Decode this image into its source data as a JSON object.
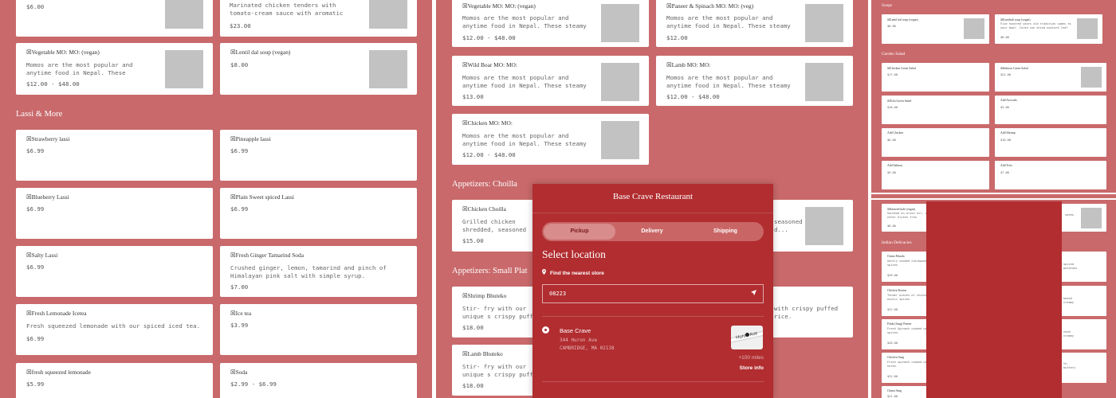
{
  "p1": {
    "top_cards": [
      {
        "price": "$6.00"
      },
      {
        "desc": "Marinated chicken tenders with tomato-cream sauce with aromatic spices. One of the most...",
        "price": "$23.00"
      }
    ],
    "veg_row": [
      {
        "name": "☒Vegetable MO: MO: (vegan)",
        "desc": "Momos are the most popular and anytime food in Nepal. These steamy and juicy dumplings a...",
        "price": "$12.00 - $48.00"
      },
      {
        "name": "☒Lentil dal soup (vegan)",
        "price": "$8.00"
      }
    ],
    "section": "Lassi & More",
    "items": [
      {
        "name": "☒Strawberry lassi",
        "price": "$6.99"
      },
      {
        "name": "☒Pineapple lassi",
        "price": "$6.99"
      },
      {
        "name": "☒Blueberry Lassi",
        "price": "$6.99"
      },
      {
        "name": "☒Plain Sweet spiced Lassi",
        "price": "$6.99"
      },
      {
        "name": "☒Salty Lassi",
        "price": "$6.99"
      },
      {
        "name": "☒Fresh Ginger Tamarind Soda",
        "desc": "Crushed ginger, lemon, tamarind and pinch of Himalayan pink salt with simple syrup.",
        "price": "$7.00"
      },
      {
        "name": "☒Fresh Lemonade Icetea",
        "desc": "Fresh squeezed lemonade with our spiced iced tea.",
        "price": "$6.99"
      },
      {
        "name": "☒Ice tea",
        "price": "$3.99"
      },
      {
        "name": "☒fresh squeezed lemonade",
        "price": "$5.99"
      },
      {
        "name": "☒Soda",
        "price": "$2.99 - $6.99"
      }
    ]
  },
  "p2": {
    "momo": [
      {
        "name": "☒Vegetable MO: MO: (vegan)",
        "desc": "Momos are the most popular and anytime food in Nepal. These steamy and juicy dumplings a...",
        "price": "$12.00 - $48.00"
      },
      {
        "name": "☒Paneer & Spinach MO: MO: (veg)",
        "desc": "Momos are the most popular and anytime food in Nepal. These steamy and juicy dumplings a...",
        "price": "$12.00"
      },
      {
        "name": "☒Wild Boar MO: MO:",
        "desc": "Momos are the most popular and anytime food in Nepal. These steamy and juicy dumplings a...",
        "price": "$13.00"
      },
      {
        "name": "☒Lamb MO: MO:",
        "desc": "Momos are the most popular and anytime food in Nepal. These steamy and juicy dumplings a...",
        "price": "$12.00 - $48.00"
      },
      {
        "name": "☒Chicken MO: MO:",
        "desc": "Momos are the most popular and anytime food in Nepal. These steamy and juicy dumplings a...",
        "price": "$12.00 - $48.00"
      }
    ],
    "section_choilla": "Appetizers: Choilla",
    "choilla": {
      "name": "☒Chicken Choilla",
      "desc": "Grilled chicken shredded, seasoned with fresh lime",
      "price": "$15.00",
      "right_desc_1": "seasoned",
      "right_desc_2": "d..."
    },
    "section_small": "Appetizers: Small Plat",
    "small": [
      {
        "name": "☒Shrimp Bhuteko",
        "desc": "Stir- fry with our unique s crispy puffed rice. Delicio",
        "price": "$18.00",
        "right_desc": "with crispy puffed rice."
      },
      {
        "name": "☒Lamb Bhuteko",
        "desc": "Stir- fry with our unique s crispy puffed rice. Delicio",
        "price": "$18.00"
      }
    ]
  },
  "p3": {
    "soups": "Soups",
    "soup_items": [
      {
        "name": "☒Lentil dal soup (vegan)",
        "price": "$8.00"
      },
      {
        "name": "☒Gundruk soup (vegan)",
        "desc": "Five hundred years old tradition comes to your bowl. Cured sun dried mustard leaf blended...",
        "price": "$8.00"
      }
    ],
    "garden": "Garden Salad",
    "garden_items": [
      {
        "name": "☒Chicken Green Salad",
        "price": "$17.00"
      },
      {
        "name": "☒Salmon Green Salad",
        "price": "$22.00"
      },
      {
        "name": "☒Tofu Green Salad",
        "price": "$16.00"
      },
      {
        "name": "Add Avocado",
        "price": "$3.00"
      },
      {
        "name": "Add Chicken",
        "price": "$6.00"
      },
      {
        "name": "Add Shrimp",
        "price": "$10.00"
      },
      {
        "name": "Add Salmon",
        "price": "$9.00"
      },
      {
        "name": "Add Tofu",
        "price": "$7.00"
      }
    ],
    "kale": {
      "name": "☒Sauteed kale (vegan)",
      "desc": "Sautéed on olive oil, dry chili flakes and other Gluten free.",
      "price": "$8.00",
      "right_desc": "seeds."
    },
    "indian": "Indian Delicacies",
    "indian_items": [
      {
        "name": "Chana Masala",
        "desc": "Gently cooked chickpeas blend of herbs and spices",
        "price": "$20.00",
        "right": "spiced potatoes and"
      },
      {
        "name": "Chicken Korma",
        "desc": "Tender pieces of chicken flavored with exotic spices",
        "price": "$22.00",
        "right": "based creamy sauce"
      },
      {
        "name": "Palak (Saag) Paneer",
        "desc": "Fresh Spinach cooked with herbs and spices.",
        "price": "$20.00",
        "right": "cked creamy sauce with"
      },
      {
        "name": "Chicken Saag",
        "desc": "Fresh spinach cooked with spices and herbs.",
        "price": "$22.00",
        "right": "th, buttery sauce perfect harmony of..."
      },
      {
        "name": "Chana Saag",
        "price": "$21.00"
      }
    ]
  },
  "modal": {
    "title": "Base Crave Restaurant",
    "tabs": [
      "Pickup",
      "Delivery",
      "Shipping"
    ],
    "heading": "Select location",
    "nearest": "Find the nearest store",
    "zip": "08223",
    "store_name": "Base Crave",
    "store_line1": "344 Huron Ave",
    "store_line2": "CAMBRIDGE, MA 02138",
    "map_label": "Huron Ave",
    "miles": "+100 miles",
    "store_info": "Store info"
  },
  "icons": {
    "pin": "location-pin-icon",
    "send": "navigation-arrow-icon"
  },
  "colors": {
    "page_bg": "#c9696b",
    "modal_bg": "#b12d30",
    "tab_active": "#d88c8c"
  }
}
